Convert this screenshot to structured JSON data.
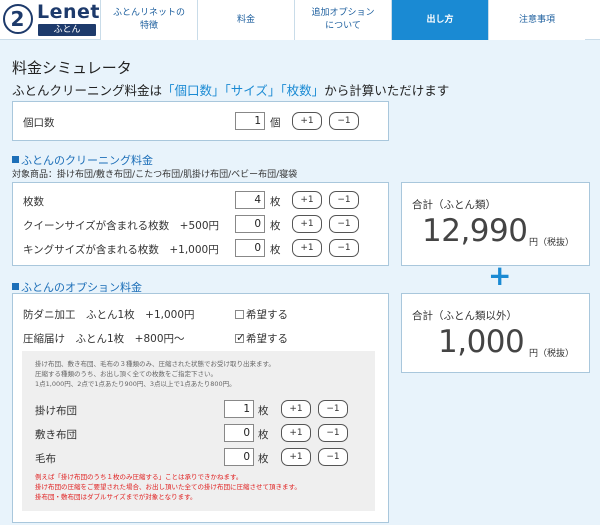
{
  "header": {
    "logo_mark": "2",
    "brand": "Lenet",
    "brand_sub": "ふとん",
    "nav": [
      {
        "label": "ふとんリネットの\n特徴"
      },
      {
        "label": "料金"
      },
      {
        "label": "追加オプション\nについて"
      },
      {
        "label": "出し方"
      },
      {
        "label": "注意事項"
      }
    ]
  },
  "page": {
    "title": "料金シミュレータ",
    "lead_prefix": "ふとんクリーニング料金は",
    "lead_h1": "「個口数」",
    "lead_h2": "「サイズ」",
    "lead_h3": "「枚数」",
    "lead_suffix": "から計算いただけます"
  },
  "packages": {
    "label": "個口数",
    "value": "1",
    "unit": "個",
    "plus": "+1",
    "minus": "−1"
  },
  "cleaning": {
    "title": "ふとんのクリーニング料金",
    "items_note": "対象商品：掛け布団/敷き布団/こたつ布団/肌掛け布団/ベビー布団/寝袋",
    "rows": [
      {
        "label": "枚数",
        "value": "4",
        "unit": "枚",
        "plus": "+1",
        "minus": "−1"
      },
      {
        "label": "クイーンサイズが含まれる枚数　+500円",
        "value": "0",
        "unit": "枚",
        "plus": "+1",
        "minus": "−1"
      },
      {
        "label": "キングサイズが含まれる枚数　+1,000円",
        "value": "0",
        "unit": "枚",
        "plus": "+1",
        "minus": "−1"
      }
    ]
  },
  "total1": {
    "label": "合計（ふとん類）",
    "value": "12,990",
    "unit": "円（税抜）"
  },
  "plus_sign": "+",
  "total2": {
    "label": "合計（ふとん類以外）",
    "value": "1,000",
    "unit": "円（税抜）"
  },
  "option": {
    "title": "ふとんのオプション料金",
    "mite": {
      "label": "防ダニ加工　ふとん1枚　+1,000円",
      "check_label": "希望する",
      "checked": false
    },
    "compress": {
      "label": "圧縮届け　ふとん1枚　+800円〜",
      "check_label": "希望する",
      "checked": true
    },
    "gray_note": "掛け布団、敷き布団、毛布の３種類のみ、圧縮された状態でお受け取り出来ます。\n圧縮する種類のうち、お出し頂く全ての枚数をご指定下さい。\n1点1,000円、2点で1点あたり900円、3点以上で1点あたり800円。",
    "rows": [
      {
        "label": "掛け布団",
        "value": "1",
        "unit": "枚",
        "plus": "+1",
        "minus": "−1"
      },
      {
        "label": "敷き布団",
        "value": "0",
        "unit": "枚",
        "plus": "+1",
        "minus": "−1"
      },
      {
        "label": "毛布",
        "value": "0",
        "unit": "枚",
        "plus": "+1",
        "minus": "−1"
      }
    ],
    "red_note": "例えば「掛け布団のうち１枚のみ圧縮する」ことは承りできかねます。\n掛け布団の圧縮をご要望された場合、お出し頂いた全ての掛け布団に圧縮させて頂きます。\n掛布団・敷布団はダブルサイズまでが対象となります。"
  },
  "colors": {
    "accent": "#1a8ad3",
    "navy": "#1d3a6b",
    "red": "#e02020"
  }
}
